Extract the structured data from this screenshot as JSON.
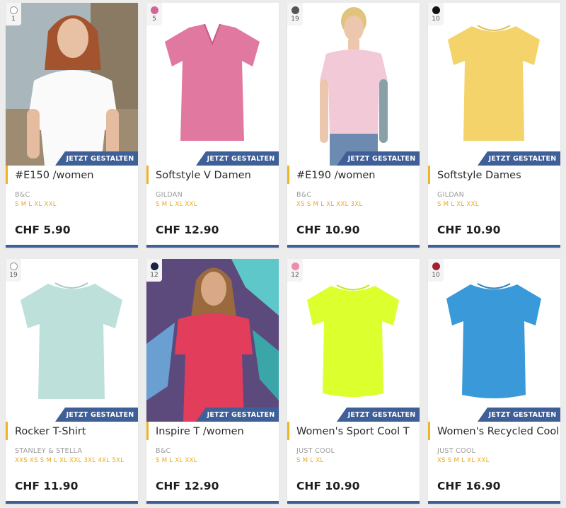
{
  "cta_label": "JETZT GESTALTEN",
  "products": [
    {
      "title": "#E150 /women",
      "brand": "B&C",
      "sizes": "S M L XL XXL",
      "price": "CHF 5.90",
      "color_count": "1",
      "swatch": "#ffffff",
      "shirt_color": "#ffffff",
      "image": "woman-white-tshirt-photo"
    },
    {
      "title": "Softstyle V Damen",
      "brand": "GILDAN",
      "sizes": "S M L XL XXL",
      "price": "CHF 12.90",
      "color_count": "5",
      "swatch": "#d4649a",
      "shirt_color": "#e0789f",
      "image": "pink-vneck-tshirt"
    },
    {
      "title": "#E190 /women",
      "brand": "B&C",
      "sizes": "XS S M L XL XXL 3XL",
      "price": "CHF 10.90",
      "color_count": "19",
      "swatch": "#555555",
      "shirt_color": "#f2c9d6",
      "image": "model-pink-tshirt-photo"
    },
    {
      "title": "Softstyle Dames",
      "brand": "GILDAN",
      "sizes": "S M L XL XXL",
      "price": "CHF 10.90",
      "color_count": "10",
      "swatch": "#111111",
      "shirt_color": "#f3d36a",
      "image": "yellow-tshirt"
    },
    {
      "title": "Rocker T-Shirt",
      "brand": "STANLEY & STELLA",
      "sizes": "XXS XS S M L XL XXL 3XL 4XL 5XL",
      "price": "CHF 11.90",
      "color_count": "19",
      "swatch": "#ffffff",
      "shirt_color": "#bde0da",
      "image": "mint-tshirt"
    },
    {
      "title": "Inspire T /women",
      "brand": "B&C",
      "sizes": "S M L XL XXL",
      "price": "CHF 12.90",
      "color_count": "12",
      "swatch": "#1a2540",
      "shirt_color": "#e23d5b",
      "image": "woman-red-tshirt-graffiti-photo"
    },
    {
      "title": "Women's Sport Cool T",
      "brand": "JUST COOL",
      "sizes": "S M L XL",
      "price": "CHF 10.90",
      "color_count": "12",
      "swatch": "#f08bb0",
      "shirt_color": "#dcff2e",
      "image": "neon-yellow-tshirt"
    },
    {
      "title": "Women's Recycled Cool T",
      "brand": "JUST COOL",
      "sizes": "XS S M L XL XXL",
      "price": "CHF 16.90",
      "color_count": "10",
      "swatch": "#a32033",
      "shirt_color": "#3a9ad9",
      "image": "blue-tshirt"
    }
  ]
}
